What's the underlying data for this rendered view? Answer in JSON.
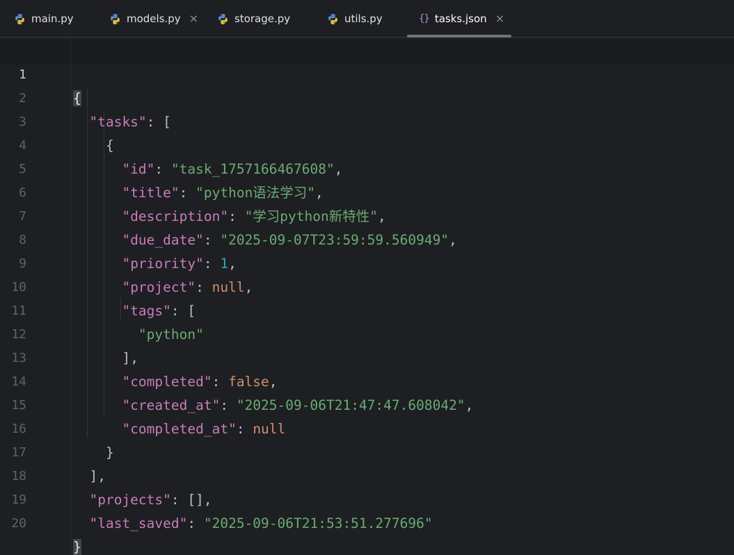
{
  "tabs": [
    {
      "label": "main.py",
      "icon": "python-file-icon",
      "active": false,
      "closable": false
    },
    {
      "label": "models.py",
      "icon": "python-file-icon",
      "active": false,
      "closable": true
    },
    {
      "label": "storage.py",
      "icon": "python-file-icon",
      "active": false,
      "closable": false
    },
    {
      "label": "utils.py",
      "icon": "python-file-icon",
      "active": false,
      "closable": false
    },
    {
      "label": "tasks.json",
      "icon": "json-file-icon",
      "active": true,
      "closable": true
    }
  ],
  "tab_close_glyph": "×",
  "json_icon_glyph": "{}",
  "editor": {
    "current_line": 1,
    "line_numbers": [
      "1",
      "2",
      "3",
      "4",
      "5",
      "6",
      "7",
      "8",
      "9",
      "10",
      "11",
      "12",
      "13",
      "14",
      "15",
      "16",
      "17",
      "18",
      "19",
      "20"
    ]
  },
  "code": {
    "l1_open": "{",
    "l2_key": "\"tasks\"",
    "l2_rest": ": [",
    "l3_open": "{",
    "l4_key": "\"id\"",
    "l4_sep": ": ",
    "l4_val": "\"task_1757166467608\"",
    "l4_end": ",",
    "l5_key": "\"title\"",
    "l5_sep": ": ",
    "l5_val": "\"python语法学习\"",
    "l5_end": ",",
    "l6_key": "\"description\"",
    "l6_sep": ": ",
    "l6_val": "\"学习python新特性\"",
    "l6_end": ",",
    "l7_key": "\"due_date\"",
    "l7_sep": ": ",
    "l7_val": "\"2025-09-07T23:59:59.560949\"",
    "l7_end": ",",
    "l8_key": "\"priority\"",
    "l8_sep": ": ",
    "l8_val": "1",
    "l8_end": ",",
    "l9_key": "\"project\"",
    "l9_sep": ": ",
    "l9_val": "null",
    "l9_end": ",",
    "l10_key": "\"tags\"",
    "l10_rest": ": [",
    "l11_val": "\"python\"",
    "l12_close": "],",
    "l13_key": "\"completed\"",
    "l13_sep": ": ",
    "l13_val": "false",
    "l13_end": ",",
    "l14_key": "\"created_at\"",
    "l14_sep": ": ",
    "l14_val": "\"2025-09-06T21:47:47.608042\"",
    "l14_end": ",",
    "l15_key": "\"completed_at\"",
    "l15_sep": ": ",
    "l15_val": "null",
    "l16_close": "}",
    "l17_close": "],",
    "l18_key": "\"projects\"",
    "l18_rest": ": [],",
    "l19_key": "\"last_saved\"",
    "l19_sep": ": ",
    "l19_val": "\"2025-09-06T21:53:51.277696\"",
    "l20_close": "}"
  },
  "colors": {
    "background": "#1e1f22",
    "key": "#c77dbb",
    "string": "#6aab73",
    "number": "#2aacb8",
    "keyword": "#cf8e6d",
    "punctuation": "#bcbec4"
  }
}
